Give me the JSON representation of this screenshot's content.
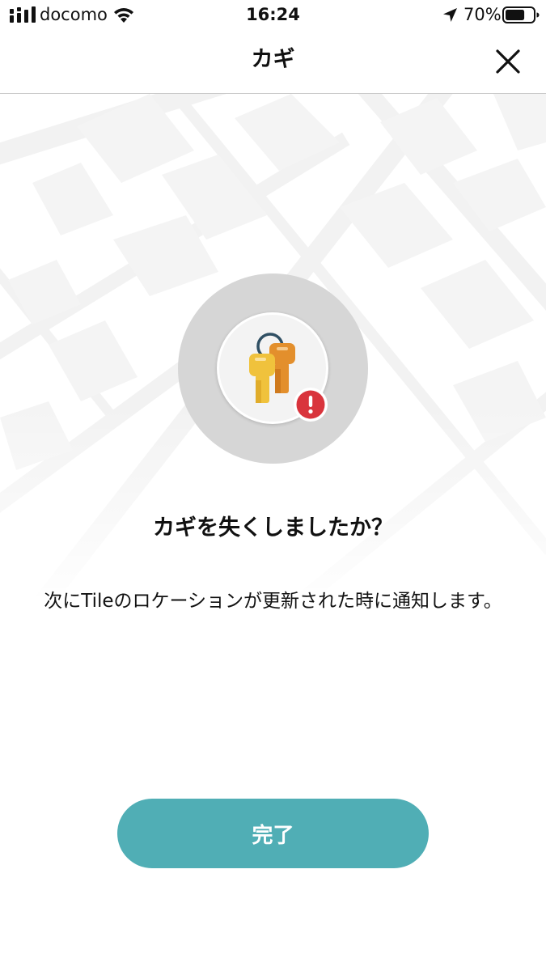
{
  "status_bar": {
    "carrier": "docomo",
    "time": "16:24",
    "battery_percent": "70%",
    "battery_level": 0.7,
    "icons": [
      "signal-bars-icon",
      "wifi-icon",
      "location-arrow-icon",
      "battery-icon"
    ]
  },
  "nav": {
    "title": "カギ",
    "close_icon": "close-icon"
  },
  "illustration": {
    "icon": "keys-icon",
    "badge_icon": "alert-icon",
    "badge_color": "#d9343c",
    "key_colors": [
      "#f0c23c",
      "#e38f2c"
    ]
  },
  "content": {
    "heading": "カギを失くしましたか？",
    "description": "次にTileのロケーションが更新された時に通知します。"
  },
  "actions": {
    "done_label": "完了",
    "accent_color": "#50aeb5"
  }
}
